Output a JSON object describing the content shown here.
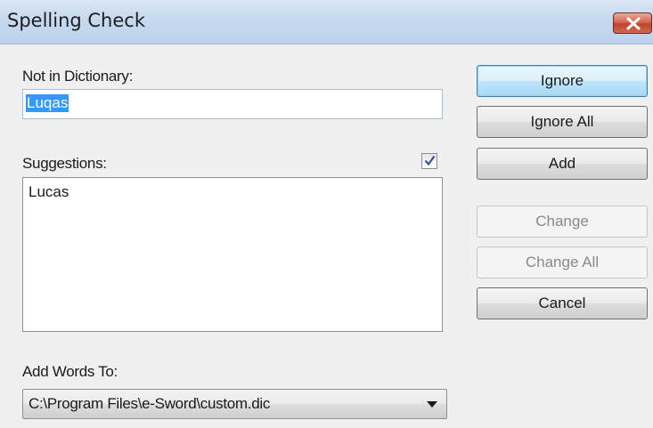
{
  "window": {
    "title": "Spelling Check",
    "close_icon": "close-icon"
  },
  "not_in_dictionary": {
    "label": "Not in Dictionary:",
    "value": "Luqas"
  },
  "suggestions": {
    "label": "Suggestions:",
    "checkbox_checked": true,
    "items": [
      "Lucas"
    ]
  },
  "buttons": {
    "ignore": "Ignore",
    "ignore_all": "Ignore All",
    "add": "Add",
    "change": "Change",
    "change_all": "Change All",
    "cancel": "Cancel"
  },
  "add_words_to": {
    "label": "Add Words To:",
    "selected": "C:\\Program Files\\e-Sword\\custom.dic"
  },
  "colors": {
    "selection": "#3399ff",
    "close_button": "#c7432b",
    "default_button_border": "#3c7fb1"
  }
}
